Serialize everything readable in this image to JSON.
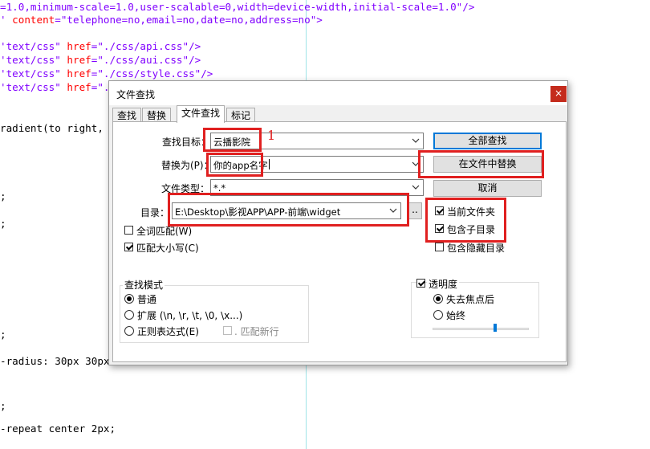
{
  "editor": {
    "lines": [
      {
        "parts": [
          {
            "t": "=1.0,minimum-scale=1.0,user-scalable=0,width=device-width,initial-scale=1.0\"/>",
            "c": "str"
          }
        ]
      },
      {
        "parts": [
          {
            "t": "' ",
            "c": "str"
          },
          {
            "t": "content",
            "c": "attr"
          },
          {
            "t": "=\"telephone=no,email=no,date=no,address=no\">",
            "c": "str"
          }
        ]
      },
      {
        "parts": [
          {
            "t": "'text/css\" ",
            "c": "str"
          },
          {
            "t": "href",
            "c": "attr"
          },
          {
            "t": "=\"./css/api.css\"/>",
            "c": "str"
          }
        ]
      },
      {
        "parts": [
          {
            "t": "'text/css\" ",
            "c": "str"
          },
          {
            "t": "href",
            "c": "attr"
          },
          {
            "t": "=\"./css/aui.css\"/>",
            "c": "str"
          }
        ]
      },
      {
        "parts": [
          {
            "t": "'text/css\" ",
            "c": "str"
          },
          {
            "t": "href",
            "c": "attr"
          },
          {
            "t": "=\"./css/style.css\"/>",
            "c": "str"
          }
        ]
      },
      {
        "parts": [
          {
            "t": "'text/css\" ",
            "c": "str"
          },
          {
            "t": "href",
            "c": "attr"
          },
          {
            "t": "=\".",
            "c": "str"
          }
        ]
      },
      {
        "parts": [
          {
            "t": "radient(to right,",
            "c": ""
          }
        ]
      },
      {
        "parts": [
          {
            "t": "-radius: 30px 30px",
            "c": ""
          }
        ]
      },
      {
        "parts": [
          {
            "t": "-repeat center 2px;",
            "c": ""
          }
        ]
      },
      {
        "parts": [
          {
            "t": ";",
            "c": ""
          }
        ]
      },
      {
        "parts": [
          {
            "t": ";",
            "c": ""
          }
        ]
      },
      {
        "parts": [
          {
            "t": ";",
            "c": ""
          }
        ]
      },
      {
        "parts": [
          {
            "t": ";",
            "c": ""
          }
        ]
      }
    ]
  },
  "dialog": {
    "title": "文件查找",
    "close_glyph": "×",
    "tabs": [
      {
        "label": "查找"
      },
      {
        "label": "替换"
      },
      {
        "label": "文件查找"
      },
      {
        "label": "标记"
      }
    ],
    "find_label": "查找目标：",
    "find_value": "云播影院",
    "replace_label": "替换为(P)：",
    "replace_value": "你的app名字",
    "filter_label": "文件类型：",
    "filter_value": "*.*",
    "dir_label": "目录：",
    "dir_value": "E:\\Desktop\\影视APP\\APP-前端\\widget",
    "browse_label": "..",
    "buttons": {
      "find_all": "全部查找",
      "replace_in_files": "在文件中替换",
      "cancel": "取消"
    },
    "options": {
      "whole_word": "全词匹配(W)",
      "match_case": "匹配大小写(C)",
      "follow_current": "当前文件夹",
      "in_subfolders": "包含子目录",
      "in_hidden": "包含隐藏目录"
    },
    "search_mode": {
      "title": "查找模式",
      "normal": "普通",
      "extended": "扩展 (\\n, \\r, \\t, \\0, \\x...)",
      "regex": "正则表达式(E)",
      "dot_newline": ". 匹配新行"
    },
    "transparency": {
      "title": "透明度",
      "on_lose_focus": "失去焦点后",
      "always": "始终",
      "slider_level": 0.65
    }
  },
  "annotation": {
    "number": "1"
  },
  "colors": {
    "annotation_red": "#e02020",
    "accent_blue": "#0078d7"
  }
}
